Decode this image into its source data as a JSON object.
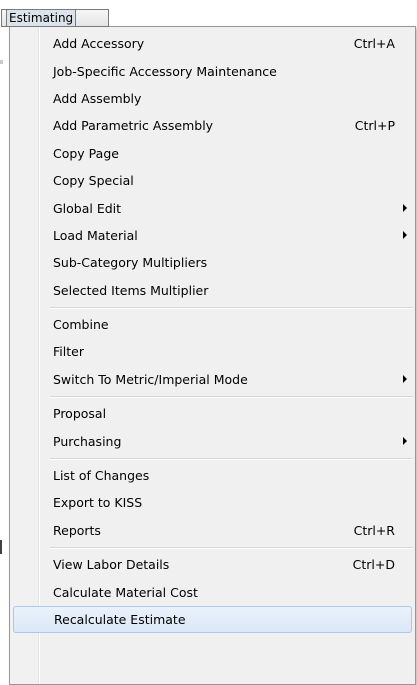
{
  "menubar": {
    "active_menu": "Estimating"
  },
  "menu": {
    "groups": [
      [
        {
          "label": "Add Accessory",
          "shortcut": "Ctrl+A",
          "submenu": false
        },
        {
          "label": "Job-Specific Accessory Maintenance",
          "shortcut": "",
          "submenu": false
        },
        {
          "label": "Add Assembly",
          "shortcut": "",
          "submenu": false
        },
        {
          "label": "Add Parametric Assembly",
          "shortcut": "Ctrl+P",
          "submenu": false
        },
        {
          "label": "Copy Page",
          "shortcut": "",
          "submenu": false
        },
        {
          "label": "Copy Special",
          "shortcut": "",
          "submenu": false
        },
        {
          "label": "Global Edit",
          "shortcut": "",
          "submenu": true
        },
        {
          "label": "Load Material",
          "shortcut": "",
          "submenu": true
        },
        {
          "label": "Sub-Category Multipliers",
          "shortcut": "",
          "submenu": false
        },
        {
          "label": "Selected Items Multiplier",
          "shortcut": "",
          "submenu": false
        }
      ],
      [
        {
          "label": "Combine",
          "shortcut": "",
          "submenu": false
        },
        {
          "label": "Filter",
          "shortcut": "",
          "submenu": false
        },
        {
          "label": "Switch To Metric/Imperial Mode",
          "shortcut": "",
          "submenu": true
        }
      ],
      [
        {
          "label": "Proposal",
          "shortcut": "",
          "submenu": false
        },
        {
          "label": "Purchasing",
          "shortcut": "",
          "submenu": true
        }
      ],
      [
        {
          "label": "List of Changes",
          "shortcut": "",
          "submenu": false
        },
        {
          "label": "Export to KISS",
          "shortcut": "",
          "submenu": false
        },
        {
          "label": "Reports",
          "shortcut": "Ctrl+R",
          "submenu": false
        }
      ],
      [
        {
          "label": "View Labor Details",
          "shortcut": "Ctrl+D",
          "submenu": false
        },
        {
          "label": "Calculate Material Cost",
          "shortcut": "",
          "submenu": false
        },
        {
          "label": "Recalculate Estimate",
          "shortcut": "",
          "submenu": false,
          "highlighted": true
        }
      ]
    ]
  },
  "colors": {
    "menu_background": "#f0f0f0",
    "highlight_background": "#dbe8f7",
    "highlight_border": "#a8c8ec",
    "separator": "#d6d6d6"
  }
}
